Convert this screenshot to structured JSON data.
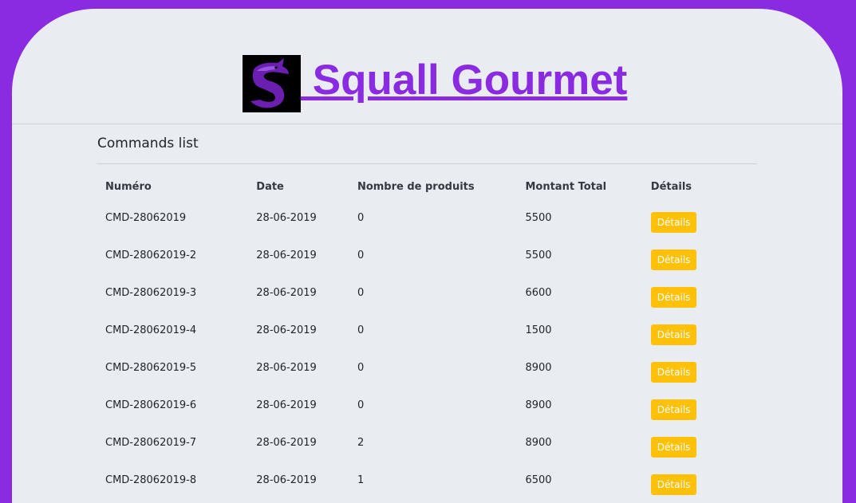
{
  "brand": {
    "name": " Squall Gourmet",
    "colors": {
      "primary": "#8a2be2",
      "button": "#ffc107",
      "panel": "#e9ecf0"
    }
  },
  "section": {
    "title": "Commands list"
  },
  "table": {
    "headers": [
      "Numéro",
      "Date",
      "Nombre de produits",
      "Montant Total",
      "Détails"
    ],
    "rows": [
      {
        "numero": "CMD-28062019",
        "date": "28-06-2019",
        "nombre": "0",
        "montant": "5500",
        "details": "Détails"
      },
      {
        "numero": "CMD-28062019-2",
        "date": "28-06-2019",
        "nombre": "0",
        "montant": "5500",
        "details": "Détails"
      },
      {
        "numero": "CMD-28062019-3",
        "date": "28-06-2019",
        "nombre": "0",
        "montant": "6600",
        "details": "Détails"
      },
      {
        "numero": "CMD-28062019-4",
        "date": "28-06-2019",
        "nombre": "0",
        "montant": "1500",
        "details": "Détails"
      },
      {
        "numero": "CMD-28062019-5",
        "date": "28-06-2019",
        "nombre": "0",
        "montant": "8900",
        "details": "Détails"
      },
      {
        "numero": "CMD-28062019-6",
        "date": "28-06-2019",
        "nombre": "0",
        "montant": "8900",
        "details": "Détails"
      },
      {
        "numero": "CMD-28062019-7",
        "date": "28-06-2019",
        "nombre": "2",
        "montant": "8900",
        "details": "Détails"
      },
      {
        "numero": "CMD-28062019-8",
        "date": "28-06-2019",
        "nombre": "1",
        "montant": "6500",
        "details": "Détails"
      }
    ]
  }
}
